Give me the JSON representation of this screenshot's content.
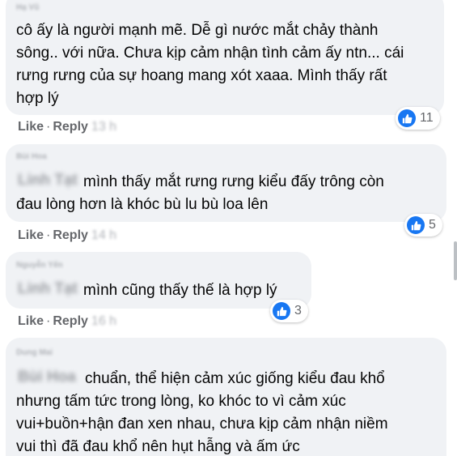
{
  "comments": [
    {
      "author": "Hạ Vũ",
      "mention": "",
      "lines": [
        "cô ấy là người mạnh mẽ. Dễ gì nước mắt chảy thành",
        "sông.. với nữa. Chưa kịp cảm nhận tình cảm ấy ntn... cái",
        "rưng rưng của sự hoang mang xót xaaa. Mình thấy rất",
        "hợp lý"
      ],
      "like": "Like",
      "reply": "Reply",
      "time": "13 h",
      "reactions": "11"
    },
    {
      "author": "Bùi Hoa",
      "mention": "Linh Tạt",
      "lines": [
        "mình thấy mắt rưng rưng kiểu đấy trông còn",
        "đau lòng hơn là khóc bù lu bù loa lên"
      ],
      "like": "Like",
      "reply": "Reply",
      "time": "14 h",
      "reactions": "5"
    },
    {
      "author": "Nguyễn Yến",
      "mention": "Linh Tạt",
      "lines": [
        "mình cũng thấy thế là hợp lý"
      ],
      "like": "Like",
      "reply": "Reply",
      "time": "16 h",
      "reactions": "3"
    },
    {
      "author": "Dung Mai",
      "mention": "Bùi Hoa",
      "lines": [
        "chuẩn, thể hiện cảm xúc giống kiểu đau khổ",
        "nhưng tấm tức trong lòng, ko khóc to vì cảm xúc",
        "vui+buồn+hận đan xen nhau, chưa kịp cảm nhận niềm",
        "vui thì đã đau khổ nên hụt hẫng và ấm ức"
      ]
    }
  ],
  "icons": {
    "reaction": "like-icon"
  },
  "colors": {
    "bubble": "#f0f2f5",
    "text": "#050505",
    "secondary": "#65676b",
    "like_blue": "#1877f2"
  }
}
